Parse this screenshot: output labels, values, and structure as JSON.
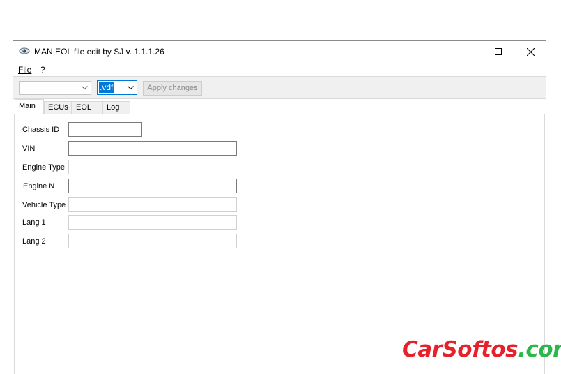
{
  "window": {
    "title": "MAN EOL file edit by SJ v. 1.1.1.26"
  },
  "menu": {
    "file": "File",
    "help": "?"
  },
  "toolbar": {
    "combo1_value": "",
    "extension_value": ".vdf",
    "apply_label": "Apply changes"
  },
  "tabs": [
    {
      "label": "Main",
      "active": true
    },
    {
      "label": "ECUs",
      "active": false
    },
    {
      "label": "EOL",
      "active": false
    },
    {
      "label": "Log",
      "active": false
    }
  ],
  "fields": {
    "chassis_id": {
      "label": "Chassis ID",
      "value": ""
    },
    "vin": {
      "label": "VIN",
      "value": ""
    },
    "engine_type": {
      "label": "Engine Type",
      "value": ""
    },
    "engine_n": {
      "label": "Engine N",
      "value": ""
    },
    "vehicle_type": {
      "label": "Vehicle Type",
      "value": ""
    },
    "lang1": {
      "label": "Lang 1",
      "value": ""
    },
    "lang2": {
      "label": "Lang 2",
      "value": ""
    }
  },
  "watermark": {
    "part1": "CarSoftos",
    "part2": ".com"
  },
  "colors": {
    "accent": "#0078d7",
    "watermark_red": "#e8202a",
    "watermark_green": "#2bb84a"
  }
}
